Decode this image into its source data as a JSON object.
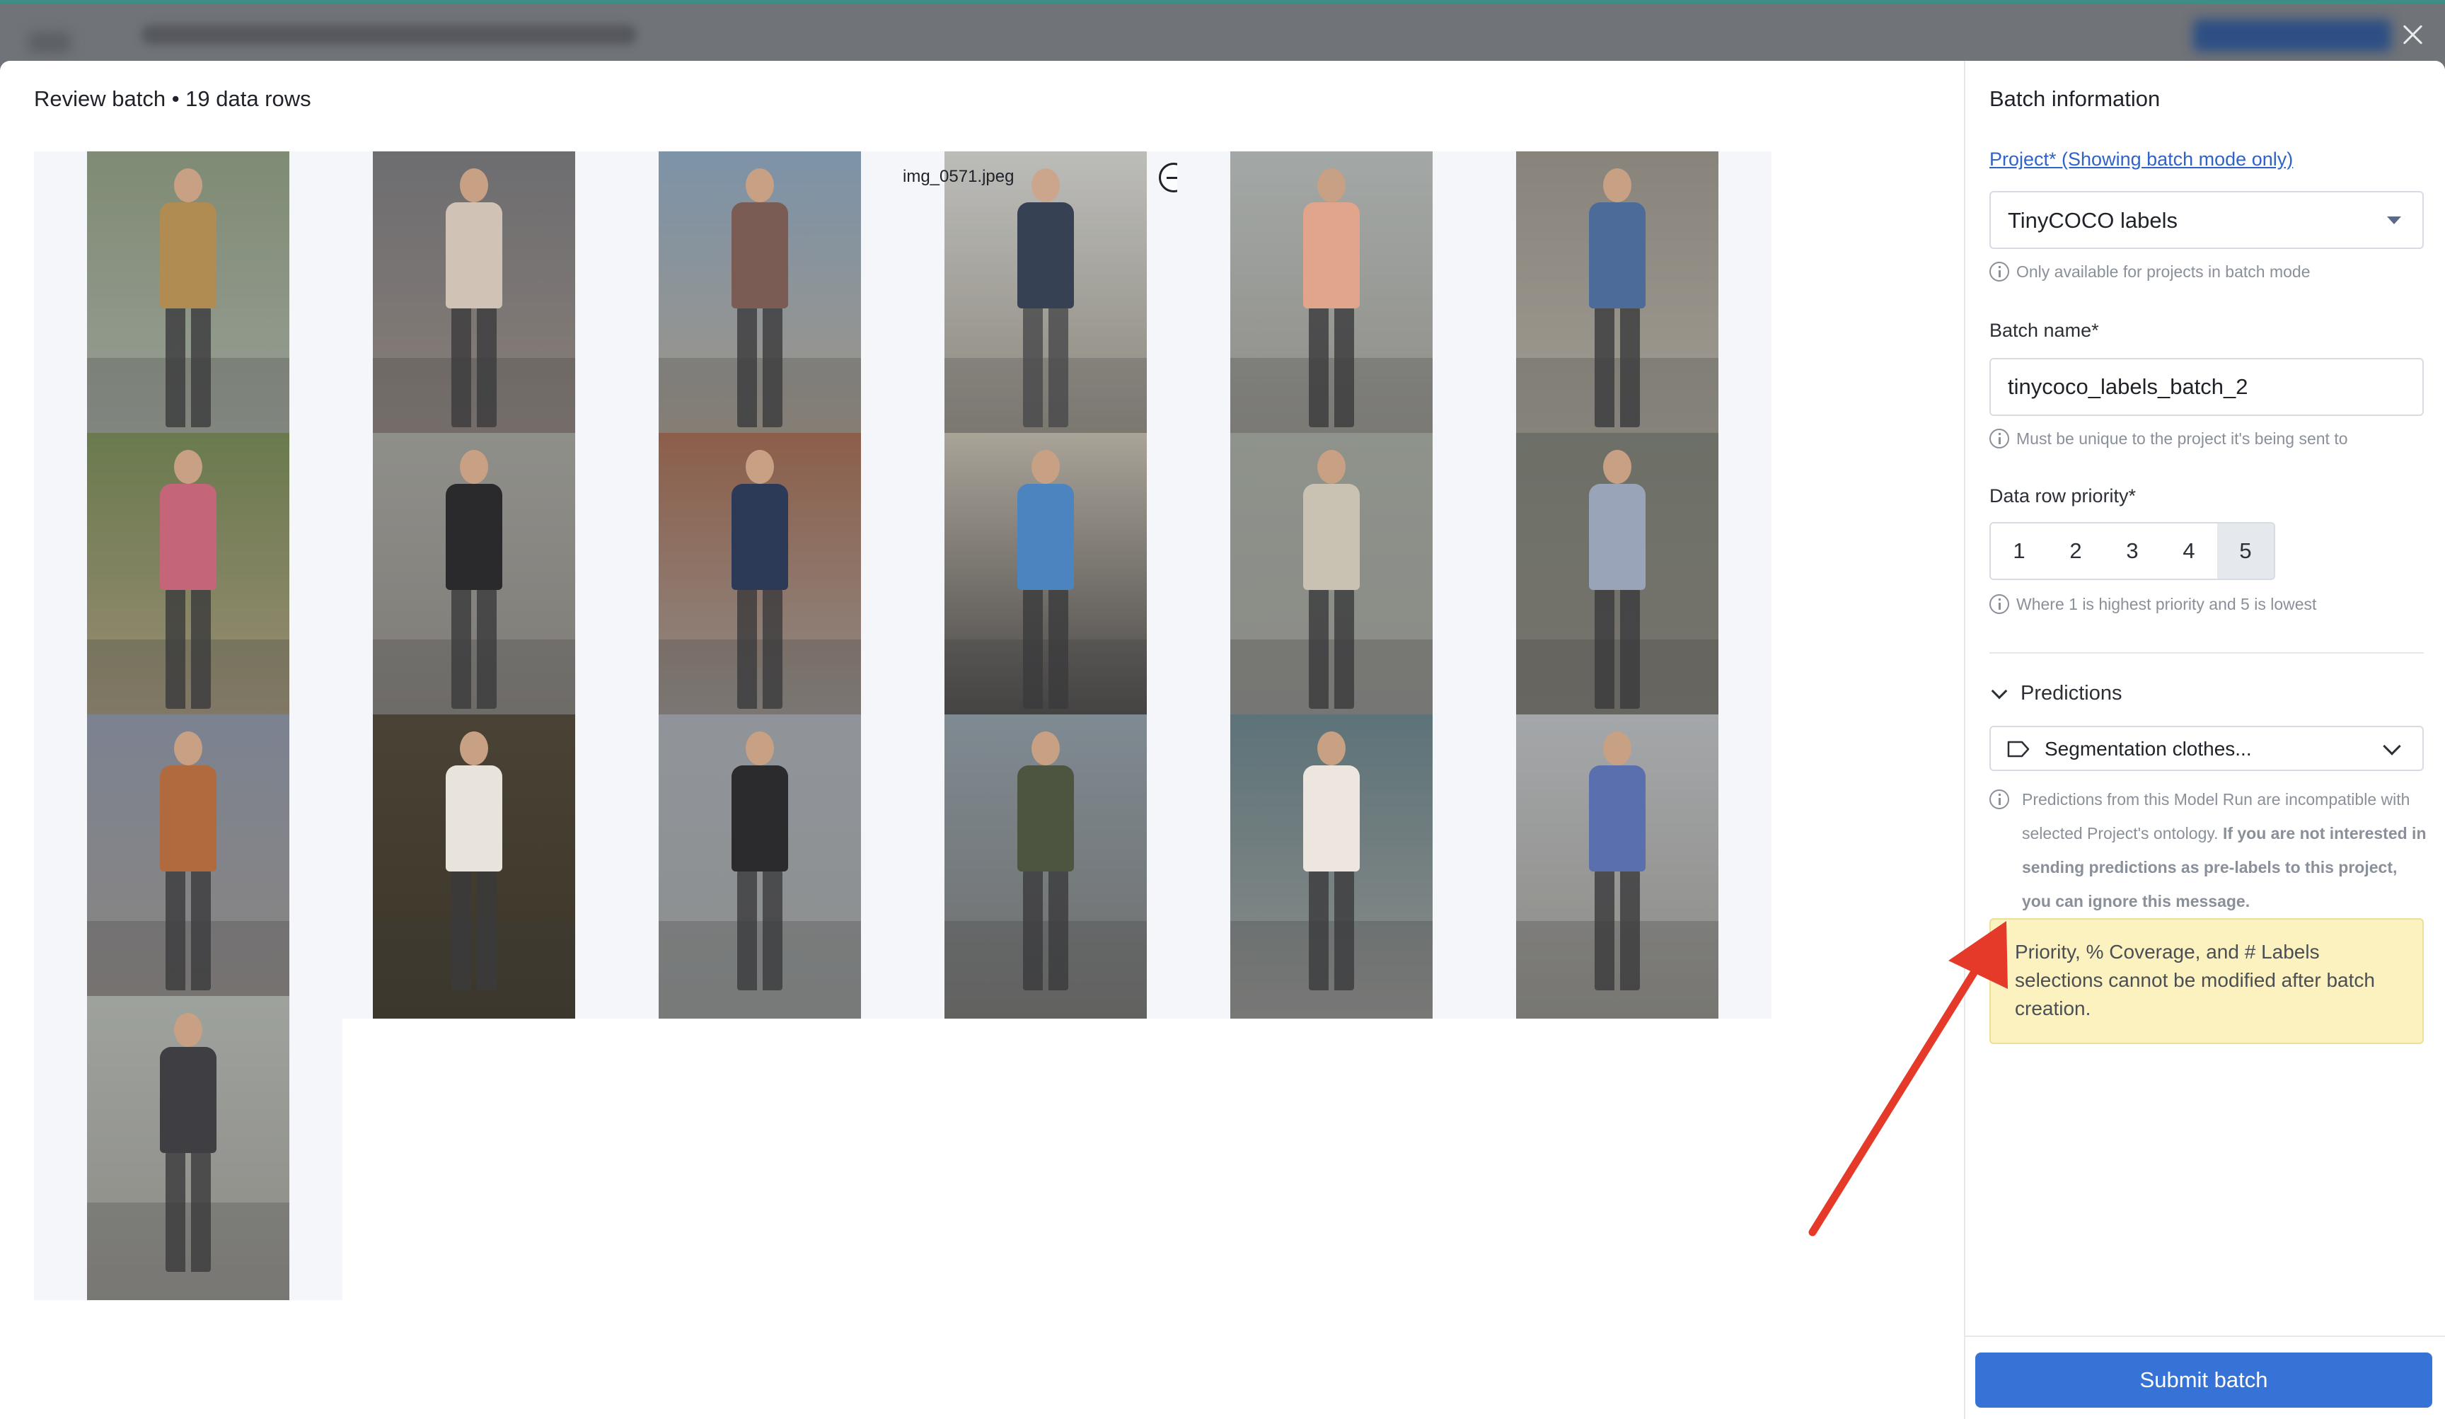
{
  "review": {
    "title": "Review batch • 19 data rows"
  },
  "grid": {
    "hover_item": {
      "filename": "img_0571.jpeg"
    },
    "items": [
      {
        "index": 1
      },
      {
        "index": 2
      },
      {
        "index": 3
      },
      {
        "index": 4
      },
      {
        "index": 5
      },
      {
        "index": 6
      },
      {
        "index": 7
      },
      {
        "index": 8
      },
      {
        "index": 9
      },
      {
        "index": 10
      },
      {
        "index": 11
      },
      {
        "index": 12
      },
      {
        "index": 13
      },
      {
        "index": 14
      },
      {
        "index": 15
      },
      {
        "index": 16
      },
      {
        "index": 17
      },
      {
        "index": 18
      },
      {
        "index": 19
      }
    ]
  },
  "side": {
    "title": "Batch information",
    "project_label": "Project* (Showing batch mode only)",
    "project_value": "TinyCOCO labels",
    "project_hint": "Only available for projects in batch mode",
    "batch_name_label": "Batch name*",
    "batch_name_value": "tinycoco_labels_batch_2",
    "batch_name_hint": "Must be unique to the project it's being sent to",
    "priority_label": "Data row priority*",
    "priority_options": [
      "1",
      "2",
      "3",
      "4",
      "5"
    ],
    "priority_selected": "5",
    "priority_hint": "Where 1 is highest priority and 5 is lowest",
    "predictions_label": "Predictions",
    "predictions_value": "Segmentation clothes...",
    "predictions_hint_normal": "Predictions from this Model Run are incompatible with selected Project's ontology.",
    "predictions_hint_bold": "If you are not interested in sending predictions as pre-labels to this project, you can ignore this message.",
    "warning": "Priority, % Coverage, and # Labels selections cannot be modified after batch creation.",
    "submit_label": "Submit batch"
  },
  "colors": {
    "accent": "#3773d6",
    "link": "#2f63c7",
    "warning_bg": "#fbf2c0",
    "annotation_arrow": "#e53a2a"
  }
}
